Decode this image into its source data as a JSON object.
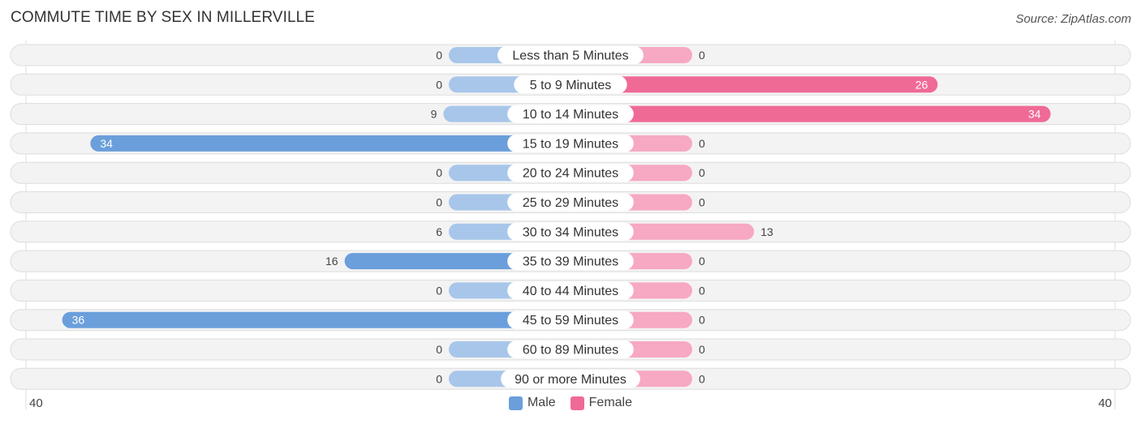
{
  "title": "COMMUTE TIME BY SEX IN MILLERVILLE",
  "source": "Source: ZipAtlas.com",
  "axis": {
    "left_label": "40",
    "right_label": "40"
  },
  "legend": [
    {
      "label": "Male",
      "color": "#6a9fdb"
    },
    {
      "label": "Female",
      "color": "#f06a96"
    }
  ],
  "colors": {
    "male_strong": "#6a9fdb",
    "male_light": "#a8c6ea",
    "female_strong": "#f06a96",
    "female_light": "#f7a8c2",
    "row_bg": "#f3f3f3",
    "row_border": "#dddddd"
  },
  "chart_data": {
    "type": "bar",
    "orientation": "horizontal-diverging",
    "title": "COMMUTE TIME BY SEX IN MILLERVILLE",
    "categories": [
      "Less than 5 Minutes",
      "5 to 9 Minutes",
      "10 to 14 Minutes",
      "15 to 19 Minutes",
      "20 to 24 Minutes",
      "25 to 29 Minutes",
      "30 to 34 Minutes",
      "35 to 39 Minutes",
      "40 to 44 Minutes",
      "45 to 59 Minutes",
      "60 to 89 Minutes",
      "90 or more Minutes"
    ],
    "series": [
      {
        "name": "Male",
        "values": [
          0,
          0,
          9,
          34,
          0,
          0,
          6,
          16,
          0,
          36,
          0,
          0
        ]
      },
      {
        "name": "Female",
        "values": [
          0,
          26,
          34,
          0,
          0,
          0,
          13,
          0,
          0,
          0,
          0,
          0
        ]
      }
    ],
    "xlim": [
      -40,
      40
    ],
    "tick_labels": [
      "40",
      "40"
    ],
    "legend_position": "bottom-center",
    "grid": false
  }
}
